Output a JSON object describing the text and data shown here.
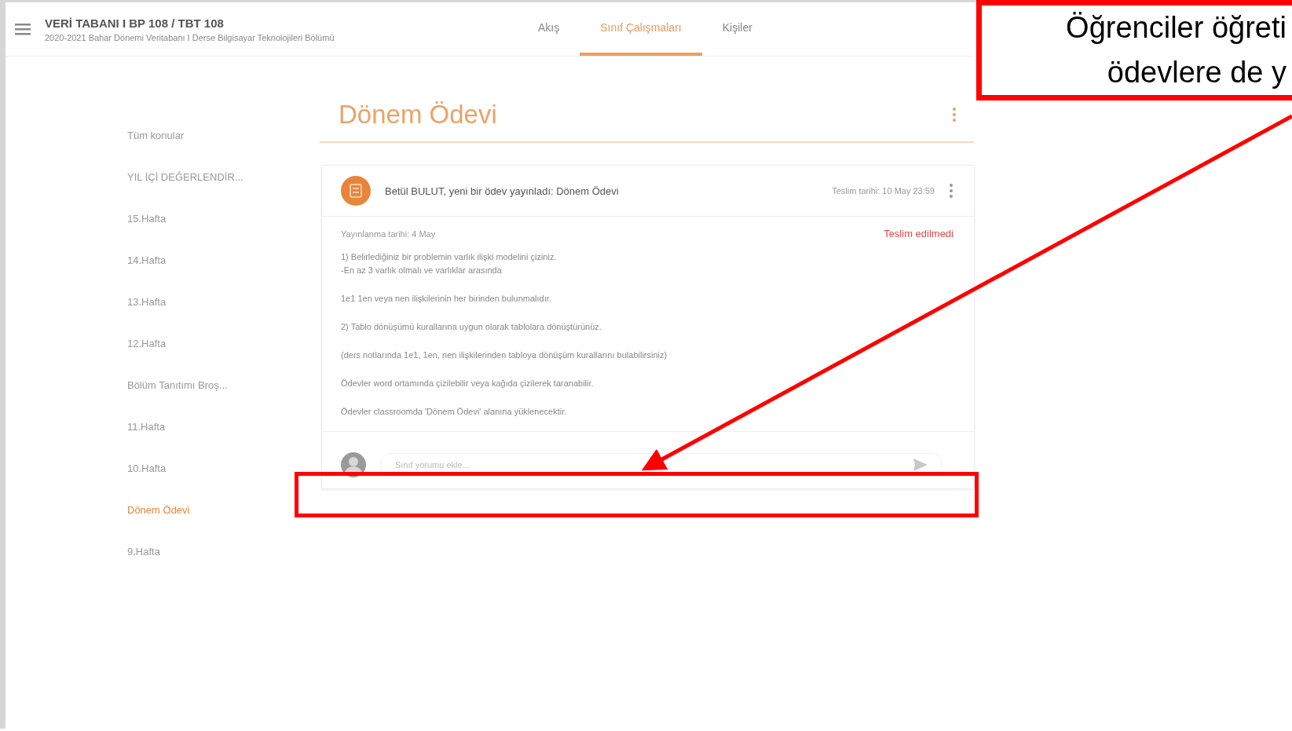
{
  "header": {
    "course_title": "VERİ TABANI I BP 108 / TBT 108",
    "course_subtitle": "2020-2021 Bahar Dönemi Veritabanı I Derse Bilgisayar Teknolojileri Bölümü"
  },
  "tabs": [
    {
      "label": "Akış",
      "selected": false
    },
    {
      "label": "Sınıf Çalışmaları",
      "selected": true
    },
    {
      "label": "Kişiler",
      "selected": false
    }
  ],
  "sidebar": {
    "items": [
      {
        "label": "Tüm konular",
        "selected": false
      },
      {
        "label": "YIL İÇİ DEĞERLENDİR...",
        "selected": false
      },
      {
        "label": "15.Hafta",
        "selected": false
      },
      {
        "label": "14.Hafta",
        "selected": false
      },
      {
        "label": "13.Hafta",
        "selected": false
      },
      {
        "label": "12.Hafta",
        "selected": false
      },
      {
        "label": "Bölüm Tanıtımı Broş...",
        "selected": false
      },
      {
        "label": "11.Hafta",
        "selected": false
      },
      {
        "label": "10.Hafta",
        "selected": false
      },
      {
        "label": "Dönem Ödevi",
        "selected": true
      },
      {
        "label": "9.Hafta",
        "selected": false
      }
    ]
  },
  "topic_title": "Dönem Ödevi",
  "post": {
    "author_line": "Betül BULUT, yeni bir ödev yayınladı: Dönem Ödevi",
    "due": "Teslim tarihi: 10 May 23:59",
    "published": "Yayınlanma tarihi: 4 May",
    "status": "Teslim edilmedi",
    "body": [
      [
        "1) Belirlediğiniz bir problemin varlık ilişki modelini çiziniz.",
        "-En az 3 varlık olmalı ve varlıklar arasında"
      ],
      [
        "1e1 1en veya nen ilişkilerinin her birinden bulunmalıdır."
      ],
      [
        "2) Tablo dönüşümü kurallarına uygun olarak tablolara dönüştürünüz."
      ],
      [
        "(ders notlarında 1e1, 1en, nen ilişkilerinden tabloya dönüşüm kurallarını bulabilirsiniz)"
      ],
      [
        "Ödevler word ortamında çizilebilir veya kağıda çizilerek taranabilir."
      ],
      [
        "Ödevler classroomda 'Dönem Ödevi' alanına yüklenecektir."
      ]
    ]
  },
  "comment": {
    "placeholder": "Sınıf yorumu ekle..."
  },
  "callout": {
    "lines": [
      "Öğrenciler öğreti",
      "ödevlere de y"
    ]
  }
}
